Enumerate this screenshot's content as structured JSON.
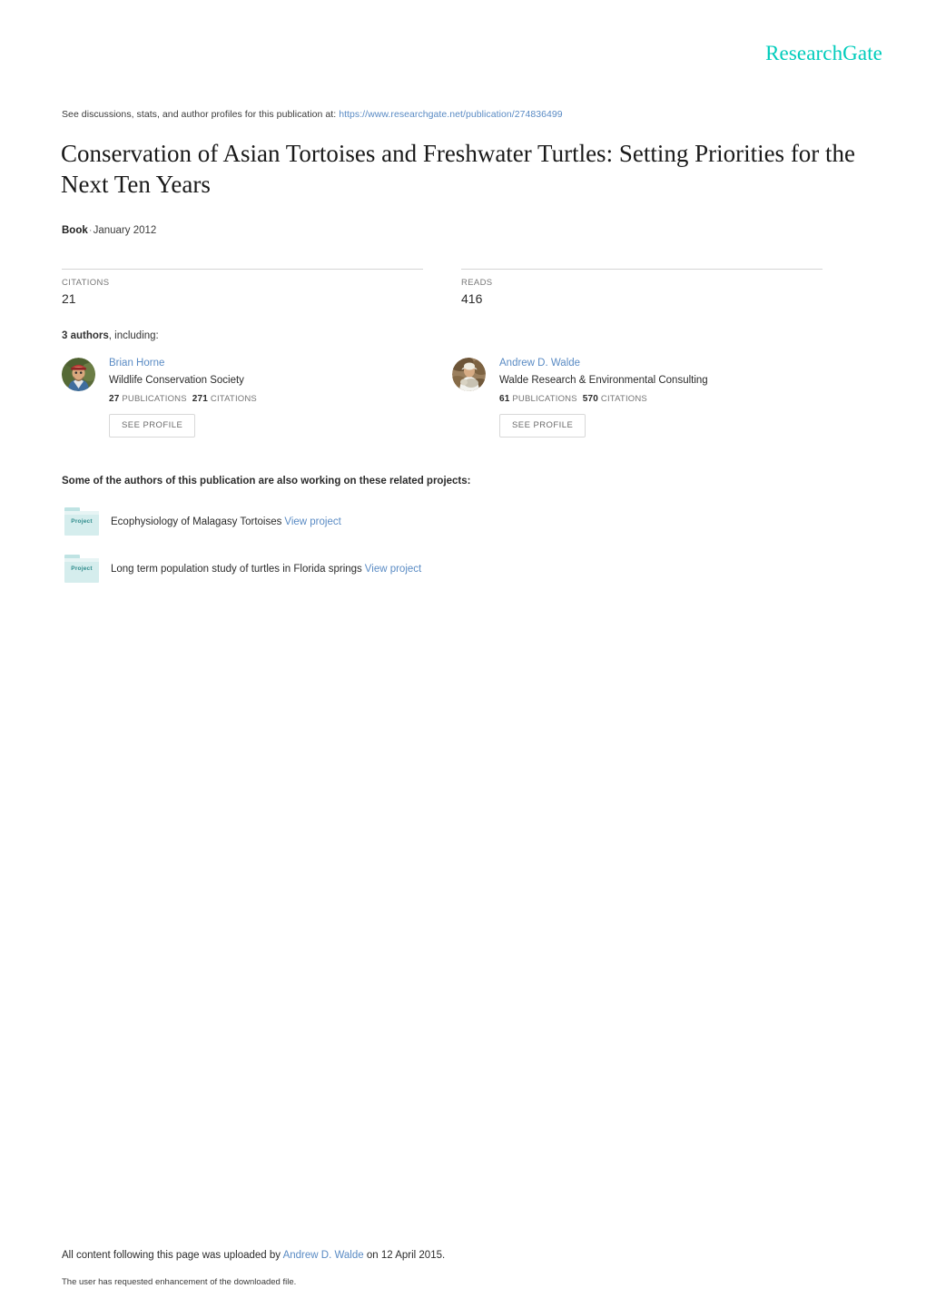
{
  "brand": {
    "name": "ResearchGate",
    "color": "#00ccbb"
  },
  "discussion": {
    "prefix": "See discussions, stats, and author profiles for this publication at:",
    "url": "https://www.researchgate.net/publication/274836499"
  },
  "publication": {
    "title": "Conservation of Asian Tortoises and Freshwater Turtles: Setting Priorities for the Next Ten Years",
    "type": "Book",
    "separator": "·",
    "date": "January 2012"
  },
  "metrics": [
    {
      "label": "CITATIONS",
      "value": "21"
    },
    {
      "label": "READS",
      "value": "416"
    }
  ],
  "authors_section": {
    "count_label": "3 authors",
    "count_suffix": ", including:",
    "authors": [
      {
        "name": "Brian Horne",
        "organization": "Wildlife Conservation Society",
        "publications_count": "27",
        "publications_label": "PUBLICATIONS",
        "citations_count": "271",
        "citations_label": "CITATIONS",
        "button_label": "SEE PROFILE"
      },
      {
        "name": "Andrew D. Walde",
        "organization": "Walde Research & Environmental Consulting",
        "publications_count": "61",
        "publications_label": "PUBLICATIONS",
        "citations_count": "570",
        "citations_label": "CITATIONS",
        "button_label": "SEE PROFILE"
      }
    ]
  },
  "projects_section": {
    "heading": "Some of the authors of this publication are also working on these related projects:",
    "icon_label": "Project",
    "view_label": "View project",
    "projects": [
      {
        "title": "Ecophysiology of Malagasy Tortoises"
      },
      {
        "title": "Long term population study of turtles in Florida springs"
      }
    ]
  },
  "footer": {
    "upload_prefix": "All content following this page was uploaded by",
    "uploader": "Andrew D. Walde",
    "upload_suffix": "on 12 April 2015.",
    "enhancement_note": "The user has requested enhancement of the downloaded file."
  },
  "colors": {
    "link": "#5a8bc4",
    "brand": "#00ccbb",
    "project_icon": "#d5eded"
  }
}
